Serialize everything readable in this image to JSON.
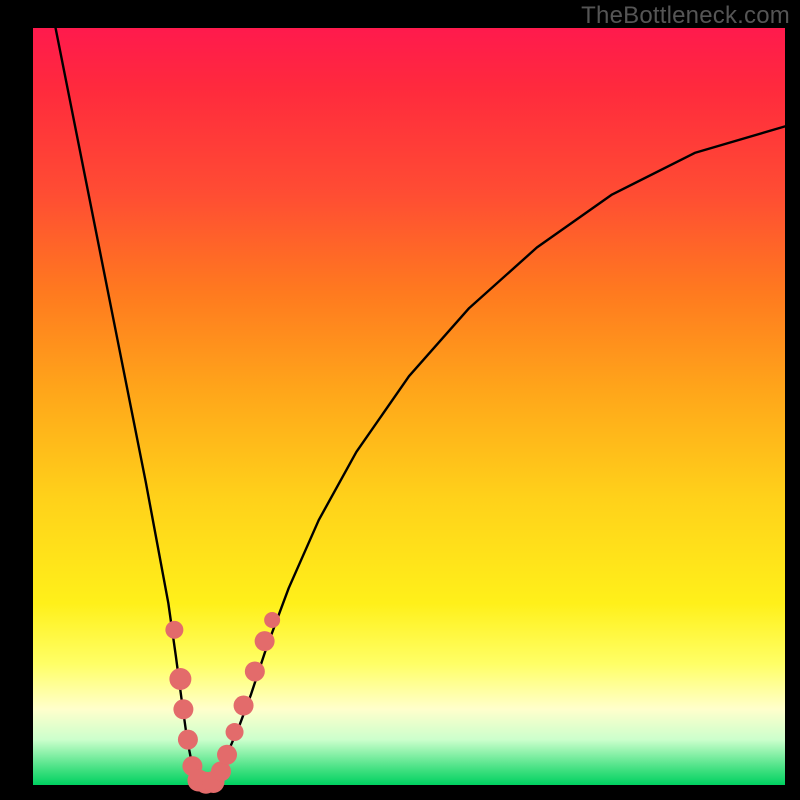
{
  "watermark": "TheBottleneck.com",
  "frame": {
    "outer_width": 800,
    "outer_height": 800,
    "border_left": 33,
    "border_right": 15,
    "border_top": 28,
    "border_bottom": 15
  },
  "chart_data": {
    "type": "line",
    "title": "",
    "xlabel": "",
    "ylabel": "",
    "xlim": [
      0,
      100
    ],
    "ylim": [
      0,
      100
    ],
    "grid": false,
    "series": [
      {
        "name": "left-branch",
        "x": [
          3,
          5,
          7,
          9,
          11,
          13,
          15,
          16.5,
          18,
          19,
          19.8,
          20.5,
          21.2,
          22
        ],
        "values": [
          100,
          90,
          80,
          70,
          60,
          50,
          40,
          32,
          24,
          17,
          11,
          6,
          2.5,
          0
        ]
      },
      {
        "name": "right-branch",
        "x": [
          24,
          25,
          26,
          27.5,
          29,
          31,
          34,
          38,
          43,
          50,
          58,
          67,
          77,
          88,
          100
        ],
        "values": [
          0,
          2,
          4.5,
          8,
          12,
          18,
          26,
          35,
          44,
          54,
          63,
          71,
          78,
          83.5,
          87
        ]
      }
    ],
    "markers": {
      "name": "highlight-dots",
      "color": "#e36b6b",
      "radius_major": 11,
      "radius_minor": 8,
      "points": [
        {
          "x": 18.8,
          "y": 20.5,
          "r": 9
        },
        {
          "x": 19.6,
          "y": 14.0,
          "r": 11
        },
        {
          "x": 20.0,
          "y": 10.0,
          "r": 10
        },
        {
          "x": 20.6,
          "y": 6.0,
          "r": 10
        },
        {
          "x": 21.2,
          "y": 2.5,
          "r": 10
        },
        {
          "x": 22.0,
          "y": 0.6,
          "r": 11
        },
        {
          "x": 23.0,
          "y": 0.3,
          "r": 11
        },
        {
          "x": 24.0,
          "y": 0.4,
          "r": 11
        },
        {
          "x": 25.0,
          "y": 1.8,
          "r": 10
        },
        {
          "x": 25.8,
          "y": 4.0,
          "r": 10
        },
        {
          "x": 26.8,
          "y": 7.0,
          "r": 9
        },
        {
          "x": 28.0,
          "y": 10.5,
          "r": 10
        },
        {
          "x": 29.5,
          "y": 15.0,
          "r": 10
        },
        {
          "x": 30.8,
          "y": 19.0,
          "r": 10
        },
        {
          "x": 31.8,
          "y": 21.8,
          "r": 8
        }
      ]
    }
  }
}
